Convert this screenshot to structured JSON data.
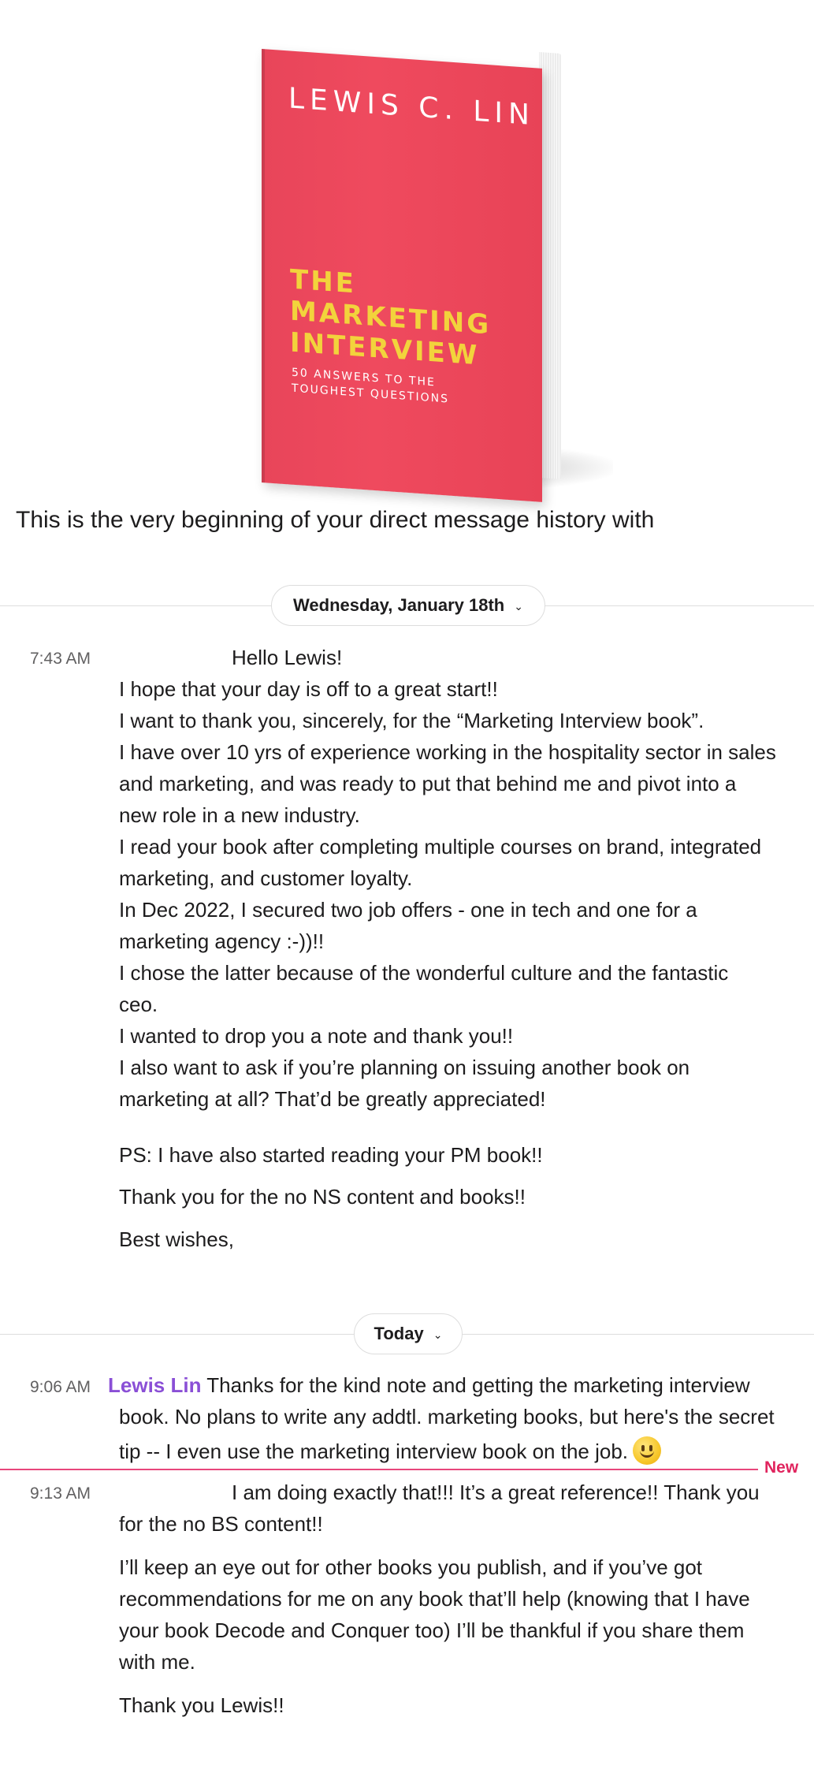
{
  "book": {
    "author": "LEWIS C. LIN",
    "title_lines": [
      "THE",
      "MARKETING",
      "INTERVIEW"
    ],
    "subtitle_lines": [
      "50 ANSWERS TO THE",
      "TOUGHEST QUESTIONS"
    ],
    "cover_color": "#ef4a5e",
    "title_color": "#f2d33c"
  },
  "intro": "This is the very beginning of your direct message history with",
  "dividers": [
    {
      "label": "Wednesday, January 18th",
      "icon": "chevron-down-icon"
    },
    {
      "label": "Today",
      "icon": "chevron-down-icon"
    }
  ],
  "messages": [
    {
      "time": "7:43 AM",
      "lines": [
        "Hello Lewis!",
        "I hope that your day is off to a great start!!",
        "I want to thank you, sincerely, for the “Marketing Interview book”.",
        "I have over 10 yrs of experience working in the hospitality sector in sales",
        "and marketing, and was ready to put that behind me and pivot into a",
        "new role in a new industry.",
        "I read your book after completing multiple courses on brand, integrated",
        "marketing, and customer loyalty.",
        " In Dec 2022, I secured two job offers - one in tech and one for a",
        "marketing agency :-))!!",
        "I chose the latter because of the wonderful culture and the fantastic",
        "ceo.",
        "I wanted to drop you a note and thank you!!",
        "I also want to ask if you’re planning on issuing another book on",
        "marketing at all? That’d be greatly appreciated!",
        "PS: I have also started reading your PM book!!",
        "Thank you for the no NS content and books!!",
        "Best wishes,"
      ]
    },
    {
      "time": "9:06 AM",
      "sender": "Lewis Lin",
      "lines": [
        "Thanks for the kind note and getting the marketing interview",
        "book. No plans to write any addtl. marketing books, but here's the secret",
        "tip -- I even use the marketing interview book on the job."
      ],
      "emoji": "slightly-smiling-face-icon"
    },
    {
      "time": "9:13 AM",
      "lines": [
        "I am doing exactly that!!! It’s a great reference!! Thank you",
        "for the no BS content!!",
        "I’ll keep an eye out for other books you publish, and if you’ve got",
        "recommendations for me on any book that’ll help (knowing that I have",
        "your book Decode and Conquer too) I’ll be thankful if you share them",
        "with me.",
        "Thank you Lewis!!"
      ]
    }
  ],
  "new_marker": "New",
  "colors": {
    "sender": "#8a4fd6",
    "new_marker": "#e0245e",
    "divider": "#dddddd"
  }
}
